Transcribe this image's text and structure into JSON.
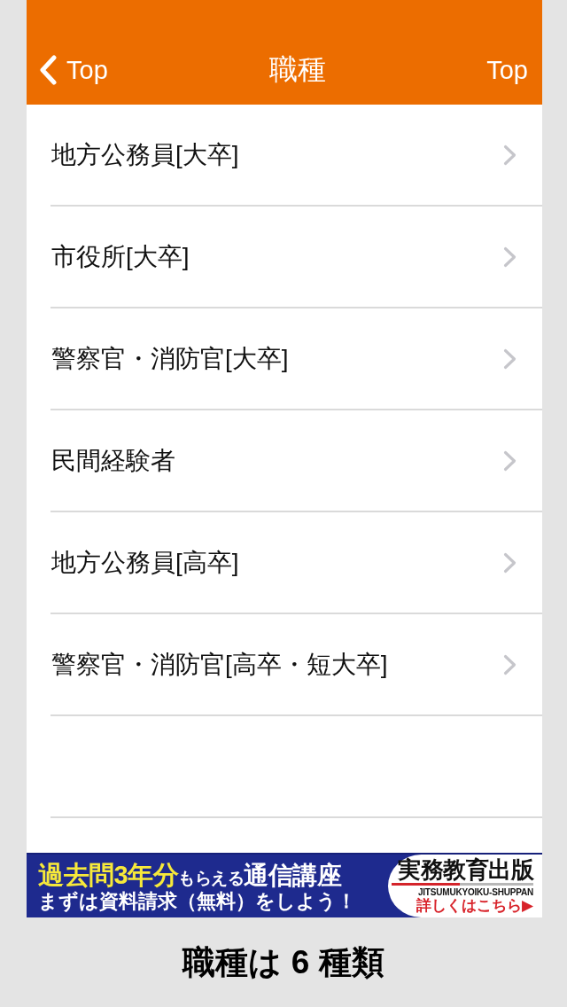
{
  "nav_bar": {
    "back_button": "Top",
    "title": "職種",
    "right_button": "Top"
  },
  "list": {
    "items": [
      {
        "label": "地方公務員[大卒]"
      },
      {
        "label": "市役所[大卒]"
      },
      {
        "label": "警察官・消防官[大卒]"
      },
      {
        "label": "民間経験者"
      },
      {
        "label": "地方公務員[高卒]"
      },
      {
        "label": "警察官・消防官[高卒・短大卒]"
      }
    ]
  },
  "ad_banner": {
    "headline": [
      {
        "text": "過去問3年分",
        "kind": "highlight"
      },
      {
        "text": "もらえる",
        "kind": "small"
      },
      {
        "text": "通信講座",
        "kind": "large"
      }
    ],
    "subline": "まずは資料請求（無料）をしよう！",
    "publisher": "実務教育出版",
    "publisher_romaji": "JITSUMUKYOIKU-SHUPPAN",
    "link": "詳しくはこちら▶"
  },
  "caption": "職種は 6 種類"
}
